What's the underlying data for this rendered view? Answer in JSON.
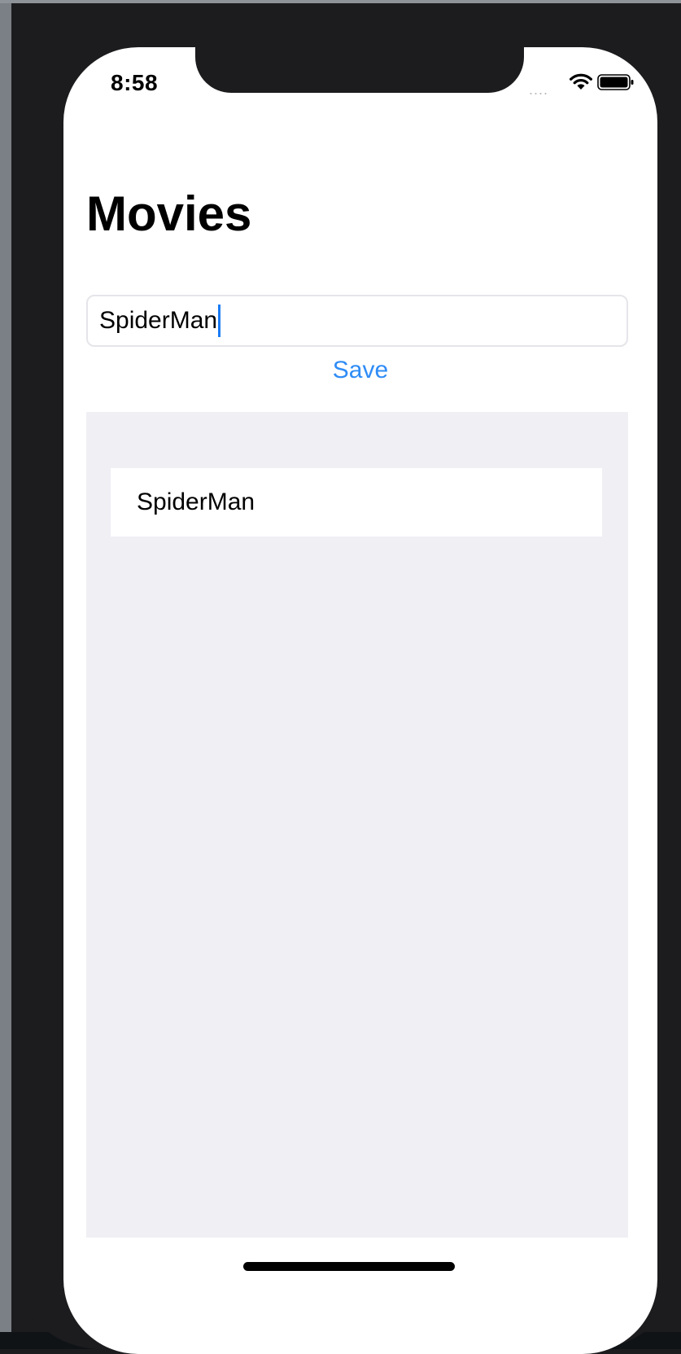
{
  "status_bar": {
    "time": "8:58",
    "signal_dots": "....",
    "wifi_icon": "wifi-icon",
    "battery_icon": "battery-icon"
  },
  "page": {
    "title": "Movies"
  },
  "form": {
    "input_value": "SpiderMan",
    "save_label": "Save"
  },
  "list": {
    "items": [
      {
        "label": "SpiderMan"
      }
    ]
  },
  "colors": {
    "accent": "#2f8cf6",
    "caret": "#1a7cf5",
    "list_background": "#efeff4",
    "device_frame": "#1c1c1e"
  }
}
